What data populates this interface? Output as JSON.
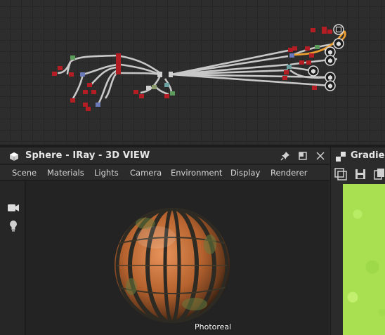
{
  "graph": {
    "accent_wire": "#f0a030",
    "wire_color": "#c8c8c8",
    "port_red": "#b31e24",
    "port_green": "#5a9a5a",
    "port_blue": "#6a7ab8"
  },
  "view3d": {
    "title": "Sphere - IRay - 3D VIEW",
    "icons": [
      "cube-icon",
      "pin-icon",
      "maximize-icon",
      "close-icon"
    ],
    "menu": [
      "Scene",
      "Materials",
      "Lights",
      "Camera",
      "Environment",
      "Display",
      "Renderer"
    ],
    "tools": [
      "camera-icon",
      "light-icon"
    ],
    "viewport_label": "Photoreal"
  },
  "gradient_panel": {
    "title": "Gradient Editor",
    "icons": [
      "checker-icon",
      "layout-icon",
      "save-icon",
      "copy-icon"
    ],
    "preview_color": "#a8e052"
  }
}
